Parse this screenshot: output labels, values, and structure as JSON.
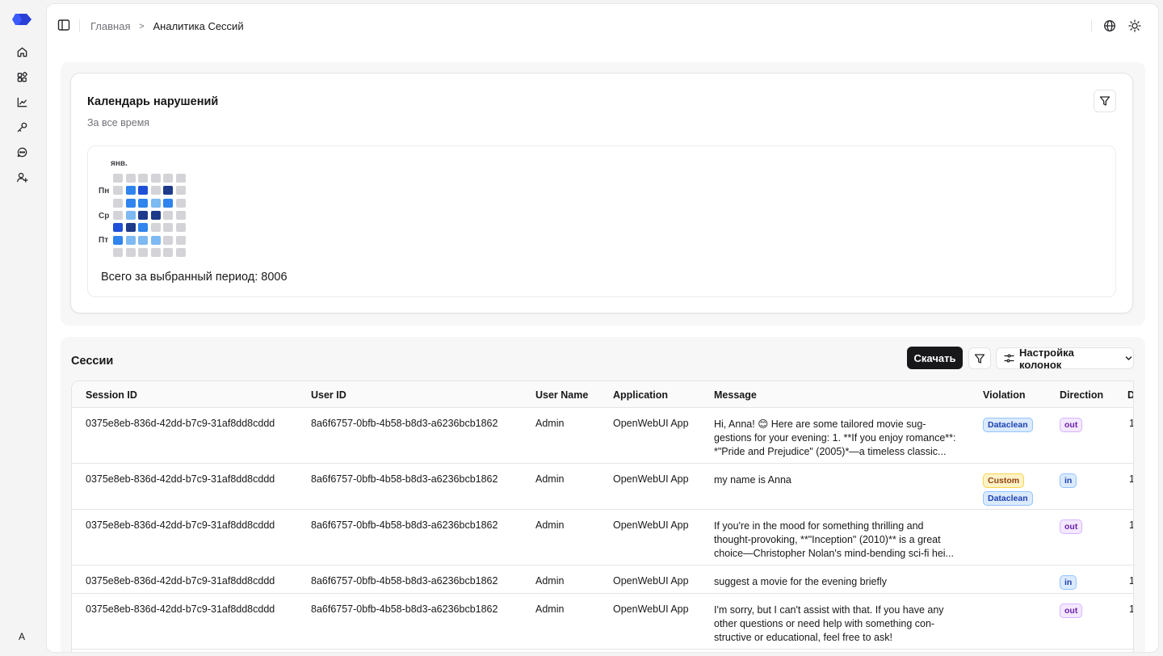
{
  "nav": {
    "items": [
      {
        "name": "home-icon"
      },
      {
        "name": "apps-icon"
      },
      {
        "name": "analytics-icon"
      },
      {
        "name": "key-icon"
      },
      {
        "name": "chat-icon"
      },
      {
        "name": "add-user-icon"
      }
    ],
    "avatar": "A"
  },
  "header": {
    "breadcrumb_home": "Главная",
    "breadcrumb_sep": ">",
    "breadcrumb_current": "Аналитика Сессий"
  },
  "calendar": {
    "title": "Календарь нарушений",
    "subtitle": "За все время",
    "month": "янв.",
    "days": [
      "Пн",
      "Ср",
      "Пт"
    ],
    "levels": [
      [
        0,
        0,
        0,
        0,
        0,
        0
      ],
      [
        0,
        3,
        4,
        0,
        5,
        0
      ],
      [
        0,
        3,
        3,
        2,
        3,
        0
      ],
      [
        0,
        2,
        5,
        5,
        0,
        0
      ],
      [
        4,
        5,
        3,
        0,
        0,
        0
      ],
      [
        3,
        2,
        2,
        2,
        0,
        0
      ],
      [
        0,
        0,
        0,
        0,
        0,
        0
      ]
    ],
    "level_colors": [
      "#d4d4d8",
      "#b9d9fb",
      "#7db9f2",
      "#2f84ee",
      "#1f4fd8",
      "#1e3a8a"
    ],
    "total_label": "Всего за выбранный период: 8006"
  },
  "sessions": {
    "title": "Сессии",
    "download_label": "Скачать",
    "columns_label": "Настройка колонок",
    "columns": [
      "Session ID",
      "User ID",
      "User Name",
      "Application",
      "Message",
      "Violation",
      "Direction",
      "D"
    ],
    "rows": [
      {
        "session_id": "0375e8eb-836d-42dd-b7c9-31af8dd8cddd",
        "user_id": "8a6f6757-0bfb-4b58-b8d3-a6236bcb1862",
        "user_name": "Admin",
        "application": "OpenWebUI App",
        "message": "Hi, Anna! 😊 Here are some tailored movie sug-\ngestions for your evening: 1. **If you enjoy romance**:\n*\"Pride and Prejudice\" (2005)*—a timeless classic...",
        "violations": [
          "Dataclean"
        ],
        "direction": "out",
        "extra": "1"
      },
      {
        "session_id": "0375e8eb-836d-42dd-b7c9-31af8dd8cddd",
        "user_id": "8a6f6757-0bfb-4b58-b8d3-a6236bcb1862",
        "user_name": "Admin",
        "application": "OpenWebUI App",
        "message": "my name is Anna",
        "violations": [
          "Custom",
          "Dataclean"
        ],
        "direction": "in",
        "extra": "1"
      },
      {
        "session_id": "0375e8eb-836d-42dd-b7c9-31af8dd8cddd",
        "user_id": "8a6f6757-0bfb-4b58-b8d3-a6236bcb1862",
        "user_name": "Admin",
        "application": "OpenWebUI App",
        "message": "If you're in the mood for something thrilling and\nthought-provoking, **\"Inception\" (2010)** is a great\nchoice—Christopher Nolan's mind-bending sci-fi hei...",
        "violations": [],
        "direction": "out",
        "extra": "1"
      },
      {
        "session_id": "0375e8eb-836d-42dd-b7c9-31af8dd8cddd",
        "user_id": "8a6f6757-0bfb-4b58-b8d3-a6236bcb1862",
        "user_name": "Admin",
        "application": "OpenWebUI App",
        "message": "suggest a movie for the evening briefly",
        "violations": [],
        "direction": "in",
        "extra": "1("
      },
      {
        "session_id": "0375e8eb-836d-42dd-b7c9-31af8dd8cddd",
        "user_id": "8a6f6757-0bfb-4b58-b8d3-a6236bcb1862",
        "user_name": "Admin",
        "application": "OpenWebUI App",
        "message": "I'm sorry, but I can't assist with that. If you have any\nother questions or need help with something con-\nstructive or educational, feel free to ask!",
        "violations": [],
        "direction": "out",
        "extra": "1"
      }
    ]
  }
}
